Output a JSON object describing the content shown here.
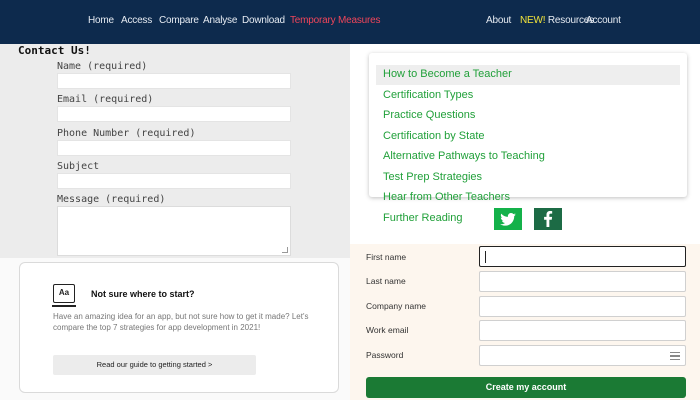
{
  "nav": {
    "left_links": [
      "Home",
      "Access",
      "Compare",
      "Analyse",
      "Download",
      "Temporary Measures"
    ],
    "new_badge": "NEW!",
    "right_links": [
      "About",
      "Resources",
      "Account"
    ],
    "active_link": "Temporary Measures",
    "colors": {
      "bar": "#0d2a4d",
      "active": "#f0455a",
      "new": "#f0e23a"
    }
  },
  "contact": {
    "title": "Contact Us!",
    "fields": [
      {
        "label": "Name (required)"
      },
      {
        "label": "Email (required)"
      },
      {
        "label": "Phone Number (required)"
      },
      {
        "label": "Subject"
      },
      {
        "label": "Message (required)"
      }
    ]
  },
  "card": {
    "icon_text": "Aa",
    "title": "Not sure where to start?",
    "body": "Have an amazing idea for an app, but not sure how to get it made? Let's compare the top 7 strategies for app development in 2021!",
    "button": "Read our guide to getting started >"
  },
  "teacher_menu": {
    "items": [
      "How to Become a Teacher",
      "Certification Types",
      "Practice Questions",
      "Certification by State",
      "Alternative Pathways to Teaching",
      "Test Prep Strategies",
      "Hear from Other Teachers",
      "Further Reading"
    ],
    "highlighted_item": "How to Become a Teacher",
    "social_icons": [
      "twitter-icon",
      "facebook-icon"
    ],
    "link_color": "#21a03a"
  },
  "signup": {
    "fields": [
      {
        "label": "First name",
        "value": ""
      },
      {
        "label": "Last name",
        "value": ""
      },
      {
        "label": "Company name",
        "value": ""
      },
      {
        "label": "Work email",
        "value": ""
      },
      {
        "label": "Password",
        "value": ""
      }
    ],
    "submit": "Create my account",
    "submit_color": "#1b7a34"
  }
}
